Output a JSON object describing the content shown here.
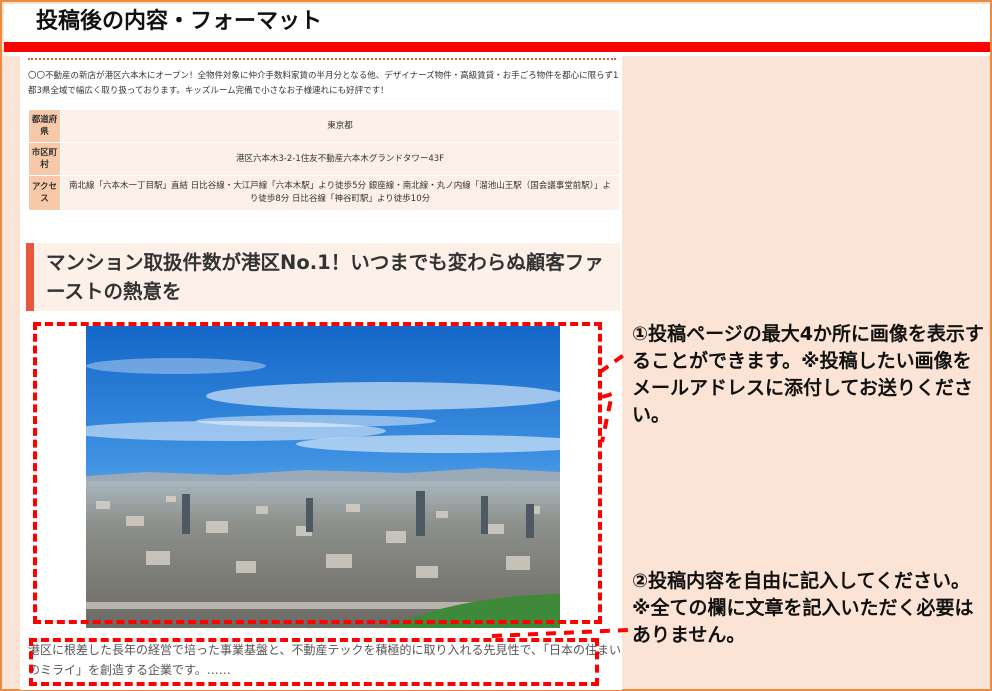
{
  "page_title": "投稿後の内容・フォーマット",
  "post": {
    "intro": "〇〇不動産の新店が港区六本木にオープン！全物件対象に仲介手数料家賃の半月分となる他、デザイナーズ物件・高級賃貸・お手ごろ物件を都心に限らず1都3県全域で幅広く取り扱っております。キッズルーム完備で小さなお子様連れにも好評です！",
    "info_table": [
      {
        "label": "都道府県",
        "value": "東京都"
      },
      {
        "label": "市区町村",
        "value": "港区六本木3-2-1住友不動産六本木グランドタワー43F"
      },
      {
        "label": "アクセス",
        "value": "南北線「六本木一丁目駅」直結 日比谷線・大江戸線「六本木駅」より徒歩5分 銀座線・南北線・丸ノ内線「溜池山王駅（国会議事堂前駅）」より徒歩8分 日比谷線「神谷町駅」より徒歩10分"
      }
    ],
    "heading": "マンション取扱件数が港区No.1！いつまでも変わらぬ顧客ファーストの熱意を",
    "excerpt": "港区に根差した長年の経営で培った事業基盤と、不動産テックを積極的に取り入れる先見性で、「日本の住まいのミライ」を創造する企業です。……"
  },
  "notes": {
    "note1": "①投稿ページの最大4か所に画像を表示することができます。※投稿したい画像をメールアドレスに添付してお送りください。",
    "note2": "②投稿内容を自由に記入してください。※全ての欄に文章を記入いただく必要はありません。"
  },
  "colors": {
    "accent_red": "#ff0000",
    "frame_orange": "#ed8b3f",
    "panel_peach": "#fbe4d5",
    "heading_bar": "#e8573a"
  },
  "icons": {
    "photo": "city-skyline-photo"
  }
}
